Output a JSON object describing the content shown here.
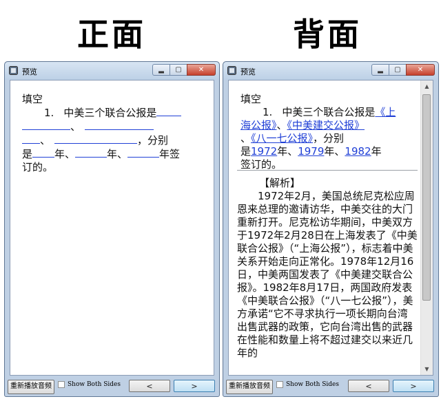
{
  "headings": {
    "front": "正面",
    "back": "背面"
  },
  "window": {
    "title": "预览",
    "min_symbol": "▂",
    "max_symbol": "▢",
    "close_symbol": "✕",
    "replay_label": "重新播放音频",
    "show_both_label": "Show Both Sides",
    "prev_label": "<",
    "next_label": ">"
  },
  "front": {
    "type_label": "填空",
    "q_num": "1.",
    "q_intro": "中美三个联合公报是",
    "sep": "、",
    "comma_fenbie": "，分别",
    "shi": "是",
    "nian": "年、",
    "nian_qian": "年签",
    "ding_de": "订的。"
  },
  "back": {
    "type_label": "填空",
    "q_num": "1.",
    "q_intro": "中美三个联合公报是",
    "ans1a": "《上",
    "ans1b": "海公报》",
    "sep1": "、",
    "ans2": "《中美建交公报》",
    "sep2": "、",
    "ans3": "《八一七公报》",
    "comma_fenbie": "，分别",
    "shi": "是",
    "y1": "1972",
    "nian1": "年、",
    "y2": "1979",
    "nian2": "年、",
    "y3": "1982",
    "nian3": "年",
    "qian_ding": "签订的。",
    "analysis_head": "【解析】",
    "analysis_body": "1972年2月，美国总统尼克松应周恩来总理的邀请访华，中美交往的大门重新打开。尼克松访华期间，中美双方于1972年2月28日在上海发表了《中美联合公报》（“上海公报”），标志着中美关系开始走向正常化。1978年12月16日，中美两国发表了《中美建交联合公报》。1982年8月17日，两国政府发表《中美联合公报》（“八一七公报”），美方承诺“它不寻求执行一项长期向台湾出售武器的政策，它向台湾出售的武器在性能和数量上将不超过建交以来近几年的"
  },
  "colors": {
    "answer_blue": "#1f3fd6",
    "window_frame": "#bfd0e4",
    "close_red": "#c6402c"
  }
}
